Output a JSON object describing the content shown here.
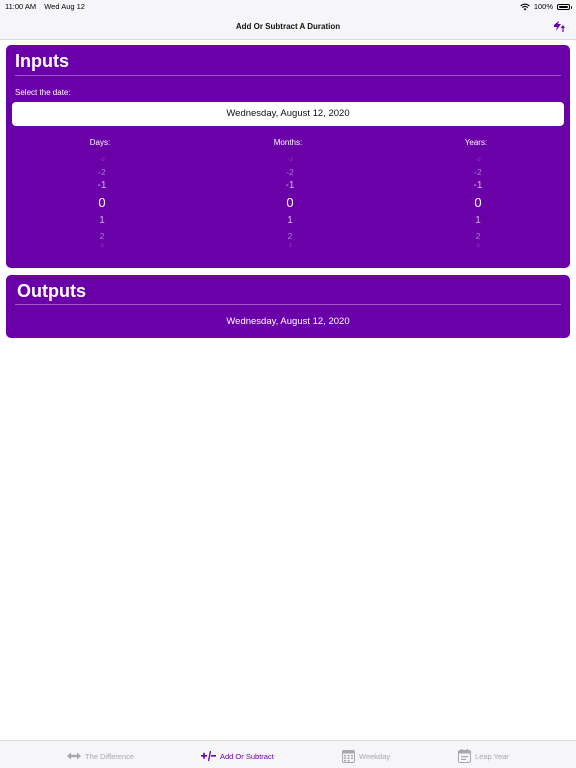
{
  "status_bar": {
    "time": "11:00 AM",
    "date": "Wed Aug 12",
    "battery": "100%",
    "icons": [
      "wifi-icon",
      "battery-icon"
    ]
  },
  "nav": {
    "title": "Add Or Subtract A Duration",
    "action_icon": "swap-arrows-icon"
  },
  "inputs": {
    "title": "Inputs",
    "select_label": "Select the date:",
    "date_value": "Wednesday, August 12, 2020",
    "pickers": [
      {
        "label": "Days:",
        "values": [
          "-3",
          "-2",
          "-1",
          "0",
          "1",
          "2",
          "3"
        ],
        "selected": "0"
      },
      {
        "label": "Months:",
        "values": [
          "-3",
          "-2",
          "-1",
          "0",
          "1",
          "2",
          "3"
        ],
        "selected": "0"
      },
      {
        "label": "Years:",
        "values": [
          "-3",
          "-2",
          "-1",
          "0",
          "1",
          "2",
          "3"
        ],
        "selected": "0"
      }
    ]
  },
  "outputs": {
    "title": "Outputs",
    "result": "Wednesday, August 12, 2020"
  },
  "tabs": [
    {
      "label": "The Difference",
      "icon": "double-arrow-icon",
      "active": false
    },
    {
      "label": "Add Or Subtract",
      "icon": "plus-minus-icon",
      "active": true
    },
    {
      "label": "Weekday",
      "icon": "calendar-icon",
      "active": false
    },
    {
      "label": "Leap Year",
      "icon": "calendar-page-icon",
      "active": false
    }
  ],
  "colors": {
    "accent": "#6a00a8",
    "bar_background": "#f6f6f8",
    "inactive_tab": "#a9a9ad"
  }
}
